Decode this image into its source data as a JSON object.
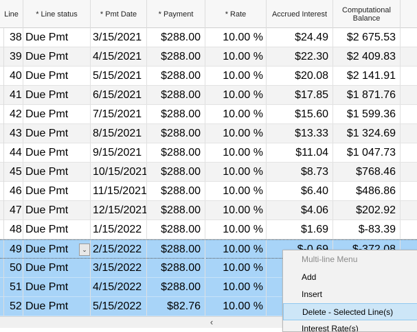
{
  "columns": {
    "line": "Line",
    "status": "* Line status",
    "date": "* Pmt Date",
    "payment": "* Payment",
    "rate": "* Rate",
    "interest": "Accrued Interest",
    "balance": "Computational Balance"
  },
  "rows": [
    {
      "line": "38",
      "status": "Due Pmt",
      "date": "3/15/2021",
      "payment": "$288.00",
      "rate": "10.00 %",
      "interest": "$24.49",
      "balance": "$2 675.53"
    },
    {
      "line": "39",
      "status": "Due Pmt",
      "date": "4/15/2021",
      "payment": "$288.00",
      "rate": "10.00 %",
      "interest": "$22.30",
      "balance": "$2 409.83"
    },
    {
      "line": "40",
      "status": "Due Pmt",
      "date": "5/15/2021",
      "payment": "$288.00",
      "rate": "10.00 %",
      "interest": "$20.08",
      "balance": "$2 141.91"
    },
    {
      "line": "41",
      "status": "Due Pmt",
      "date": "6/15/2021",
      "payment": "$288.00",
      "rate": "10.00 %",
      "interest": "$17.85",
      "balance": "$1 871.76"
    },
    {
      "line": "42",
      "status": "Due Pmt",
      "date": "7/15/2021",
      "payment": "$288.00",
      "rate": "10.00 %",
      "interest": "$15.60",
      "balance": "$1 599.36"
    },
    {
      "line": "43",
      "status": "Due Pmt",
      "date": "8/15/2021",
      "payment": "$288.00",
      "rate": "10.00 %",
      "interest": "$13.33",
      "balance": "$1 324.69"
    },
    {
      "line": "44",
      "status": "Due Pmt",
      "date": "9/15/2021",
      "payment": "$288.00",
      "rate": "10.00 %",
      "interest": "$11.04",
      "balance": "$1 047.73"
    },
    {
      "line": "45",
      "status": "Due Pmt",
      "date": "10/15/2021",
      "payment": "$288.00",
      "rate": "10.00 %",
      "interest": "$8.73",
      "balance": "$768.46"
    },
    {
      "line": "46",
      "status": "Due Pmt",
      "date": "11/15/2021",
      "payment": "$288.00",
      "rate": "10.00 %",
      "interest": "$6.40",
      "balance": "$486.86"
    },
    {
      "line": "47",
      "status": "Due Pmt",
      "date": "12/15/2021",
      "payment": "$288.00",
      "rate": "10.00 %",
      "interest": "$4.06",
      "balance": "$202.92"
    },
    {
      "line": "48",
      "status": "Due Pmt",
      "date": "1/15/2022",
      "payment": "$288.00",
      "rate": "10.00 %",
      "interest": "$1.69",
      "balance": "$-83.39"
    },
    {
      "line": "49",
      "status": "Due Pmt",
      "date": "2/15/2022",
      "payment": "$288.00",
      "rate": "10.00 %",
      "interest": "$-0.69",
      "balance": "$-372.08"
    },
    {
      "line": "50",
      "status": "Due Pmt",
      "date": "3/15/2022",
      "payment": "$288.00",
      "rate": "10.00 %",
      "interest": "",
      "balance": ""
    },
    {
      "line": "51",
      "status": "Due Pmt",
      "date": "4/15/2022",
      "payment": "$288.00",
      "rate": "10.00 %",
      "interest": "",
      "balance": ""
    },
    {
      "line": "52",
      "status": "Due Pmt",
      "date": "5/15/2022",
      "payment": "$82.76",
      "rate": "10.00 %",
      "interest": "",
      "balance": ""
    }
  ],
  "context_menu": {
    "title": "Multi-line Menu",
    "items": [
      "Add",
      "Insert",
      "Delete - Selected Line(s)",
      "Interest Rate(s)"
    ]
  },
  "colors": {
    "selection": "#a8d4f8",
    "header_bg": "#f7f7f7",
    "menu_highlight": "#cde6f7"
  },
  "icons": {
    "dropdown": "chevron-down-icon",
    "scroll_left": "arrow-left-icon"
  }
}
